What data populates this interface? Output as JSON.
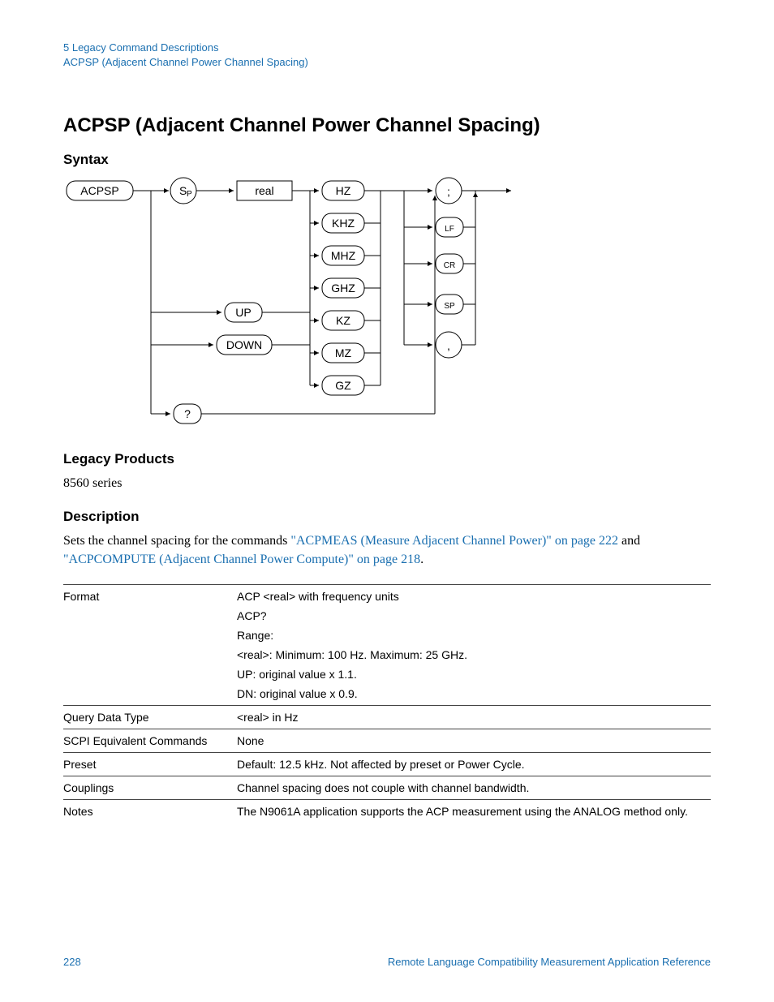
{
  "header": {
    "line1": "5  Legacy Command Descriptions",
    "line2": "ACPSP (Adjacent Channel Power Channel Spacing)"
  },
  "title": "ACPSP (Adjacent Channel Power Channel Spacing)",
  "sections": {
    "syntax_heading": "Syntax",
    "legacy_heading": "Legacy Products",
    "legacy_body": "8560 series",
    "description_heading": "Description",
    "description_prefix": "Sets the channel spacing for the commands ",
    "link1": "\"ACPMEAS (Measure Adjacent Channel Power)\" on page 222",
    "between_links": " and ",
    "link2": "\"ACPCOMPUTE (Adjacent Channel Power Compute)\" on page 218",
    "description_suffix": "."
  },
  "diagram": {
    "acpsp": "ACPSP",
    "sp_token": "S",
    "sp_token_sub": "P",
    "real": "real",
    "up": "UP",
    "down": "DOWN",
    "qmark": "?",
    "units": [
      "HZ",
      "KHZ",
      "MHZ",
      "GHZ",
      "KZ",
      "MZ",
      "GZ"
    ],
    "terminators": [
      ";",
      "LF",
      "CR",
      "SP",
      ","
    ]
  },
  "table": {
    "rows": [
      {
        "label": "Format",
        "value": "ACP <real> with frequency units"
      },
      {
        "label": "",
        "value": "ACP?"
      },
      {
        "label": "",
        "value": "Range:"
      },
      {
        "label": "",
        "value": "<real>: Minimum: 100 Hz. Maximum: 25 GHz."
      },
      {
        "label": "",
        "value": "UP: original value x 1.1."
      },
      {
        "label": "",
        "value": "DN: original value x 0.9."
      },
      {
        "label": "Query Data Type",
        "value": "<real> in Hz"
      },
      {
        "label": "SCPI Equivalent Commands",
        "value": "None"
      },
      {
        "label": "Preset",
        "value": "Default: 12.5 kHz. Not affected by preset or Power Cycle."
      },
      {
        "label": "Couplings",
        "value": "Channel spacing does not couple with channel bandwidth."
      },
      {
        "label": "Notes",
        "value": "The N9061A application supports the ACP measurement using the ANALOG method only."
      }
    ]
  },
  "footer": {
    "page": "228",
    "doc": "Remote Language Compatibility Measurement Application Reference"
  }
}
